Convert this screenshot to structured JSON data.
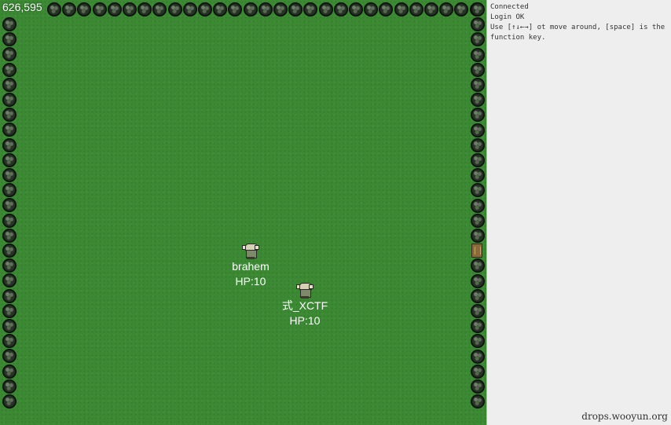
{
  "game": {
    "coordinates": "626,595",
    "players": [
      {
        "name": "brahem",
        "hp": "HP:10"
      },
      {
        "name": "式_XCTF",
        "hp": "HP:10"
      }
    ],
    "colors": {
      "grass": "#3b8a33",
      "tree": "#263326",
      "text": "#ffffff"
    }
  },
  "console": {
    "lines": [
      "Connected",
      "Login OK",
      "Use [↑↓←→] ot move around, [space] is the function key."
    ]
  },
  "watermark": "drops.wooyun.org"
}
